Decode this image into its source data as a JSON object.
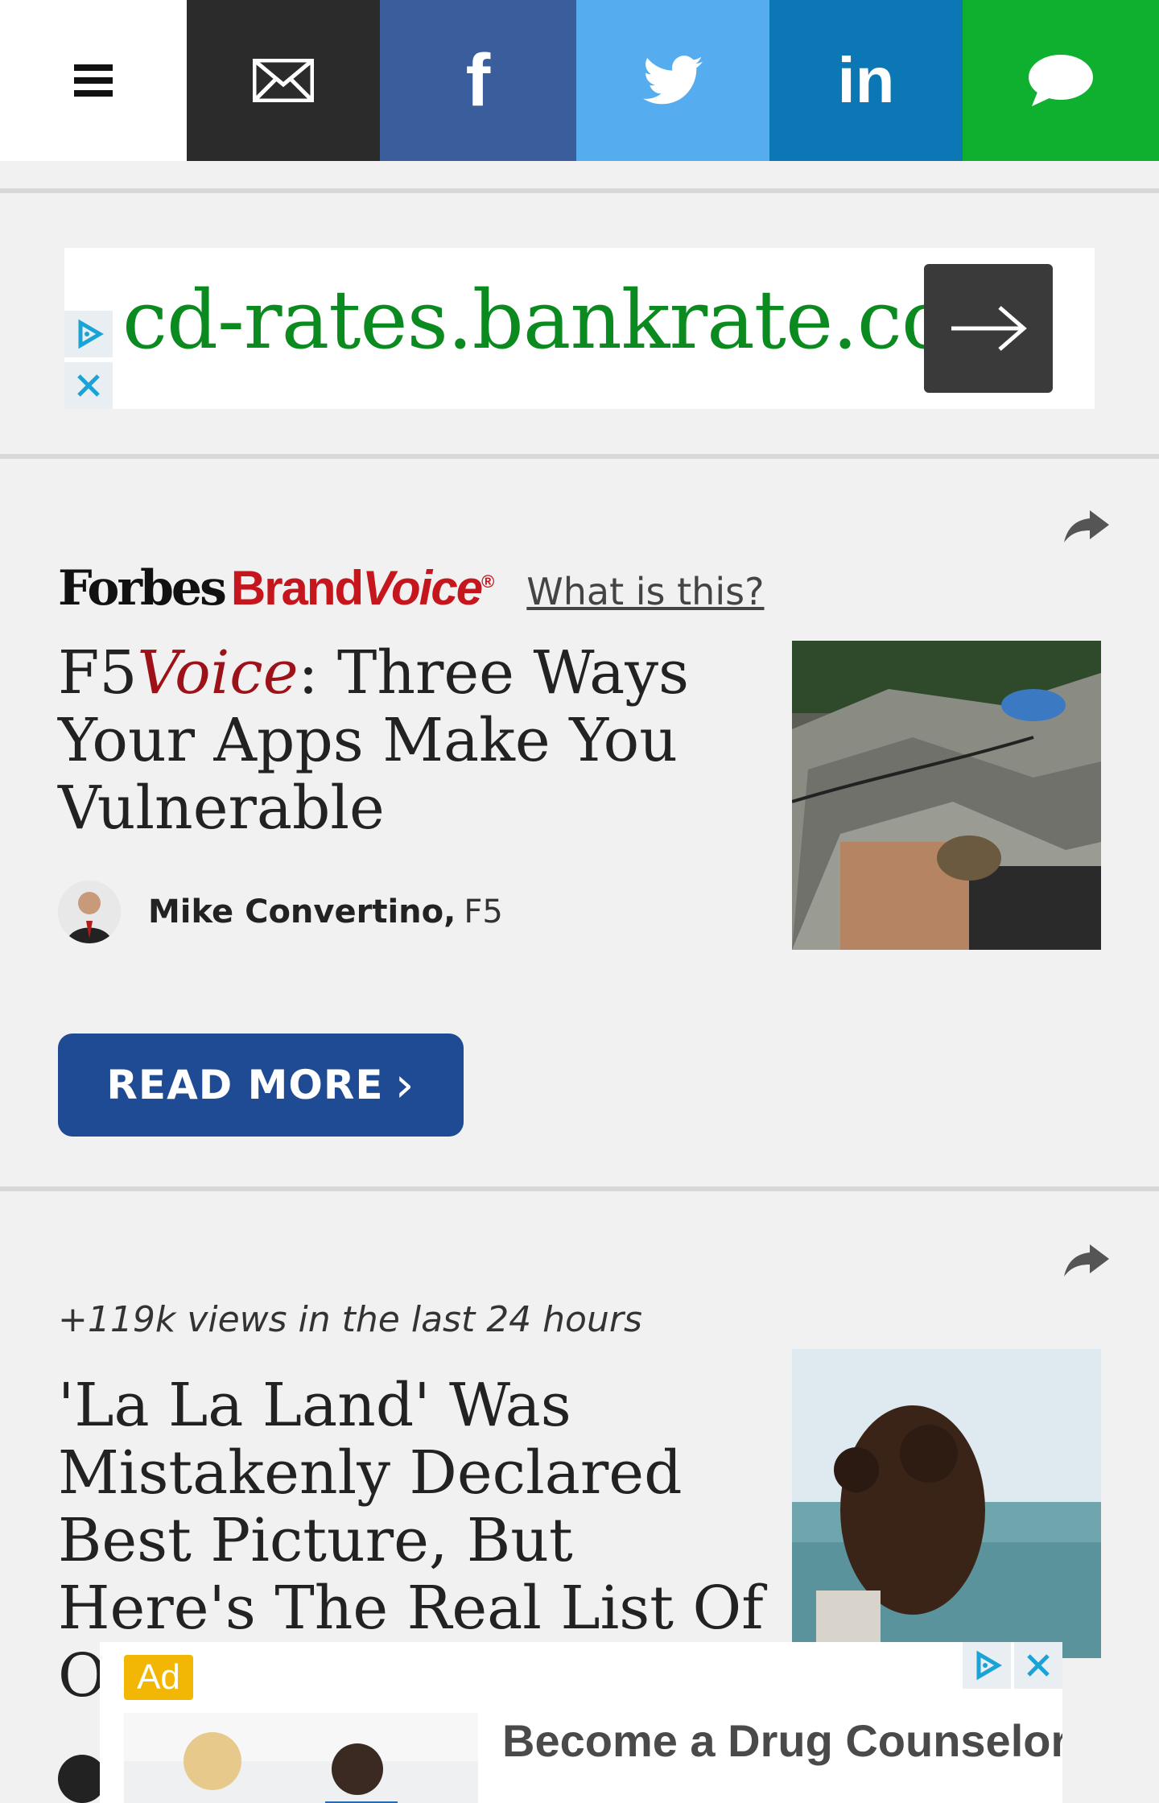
{
  "top_bar": {
    "buttons": [
      {
        "name": "menu",
        "icon": "hamburger-icon"
      },
      {
        "name": "email",
        "icon": "envelope-icon",
        "color": "#2b2b2b"
      },
      {
        "name": "facebook",
        "icon": "facebook-icon",
        "color": "#3a5d9c",
        "glyph": "f"
      },
      {
        "name": "twitter",
        "icon": "twitter-bird-icon",
        "color": "#55acee"
      },
      {
        "name": "linkedin",
        "icon": "linkedin-icon",
        "color": "#0b77b5",
        "glyph": "in"
      },
      {
        "name": "sms",
        "icon": "chat-bubble-icon",
        "color": "#0fb02f"
      }
    ]
  },
  "ad_banner": {
    "url_text": "cd-rates.bankrate.com",
    "icons": [
      "adchoices-play-icon",
      "close-icon",
      "arrow-right-icon"
    ],
    "text_color": "#0a8a1f"
  },
  "article1": {
    "brand_primary": "Forbes",
    "brand_secondary_a": "Brand",
    "brand_secondary_b": "Voice",
    "brand_reg": "®",
    "what_is_this": "What is this?",
    "title_prefix": "F5",
    "title_voice": "Voice",
    "title_rest": ": Three Ways Your Apps Make You Vulnerable",
    "author_name": "Mike Convertino,",
    "author_org": "F5",
    "read_more": "READ MORE",
    "read_more_chevron": "›",
    "accent_color": "#1f4a94"
  },
  "article2": {
    "views_text": "+119k views in the last 24 hours",
    "title": "'La La Land' Was Mistakenly Declared Best Picture, But Here's The Real List Of Oscar W"
  },
  "bottom_ad": {
    "label": "Ad",
    "headline": "Become a Drug Counselor",
    "icons": [
      "adchoices-play-icon",
      "close-icon"
    ]
  }
}
